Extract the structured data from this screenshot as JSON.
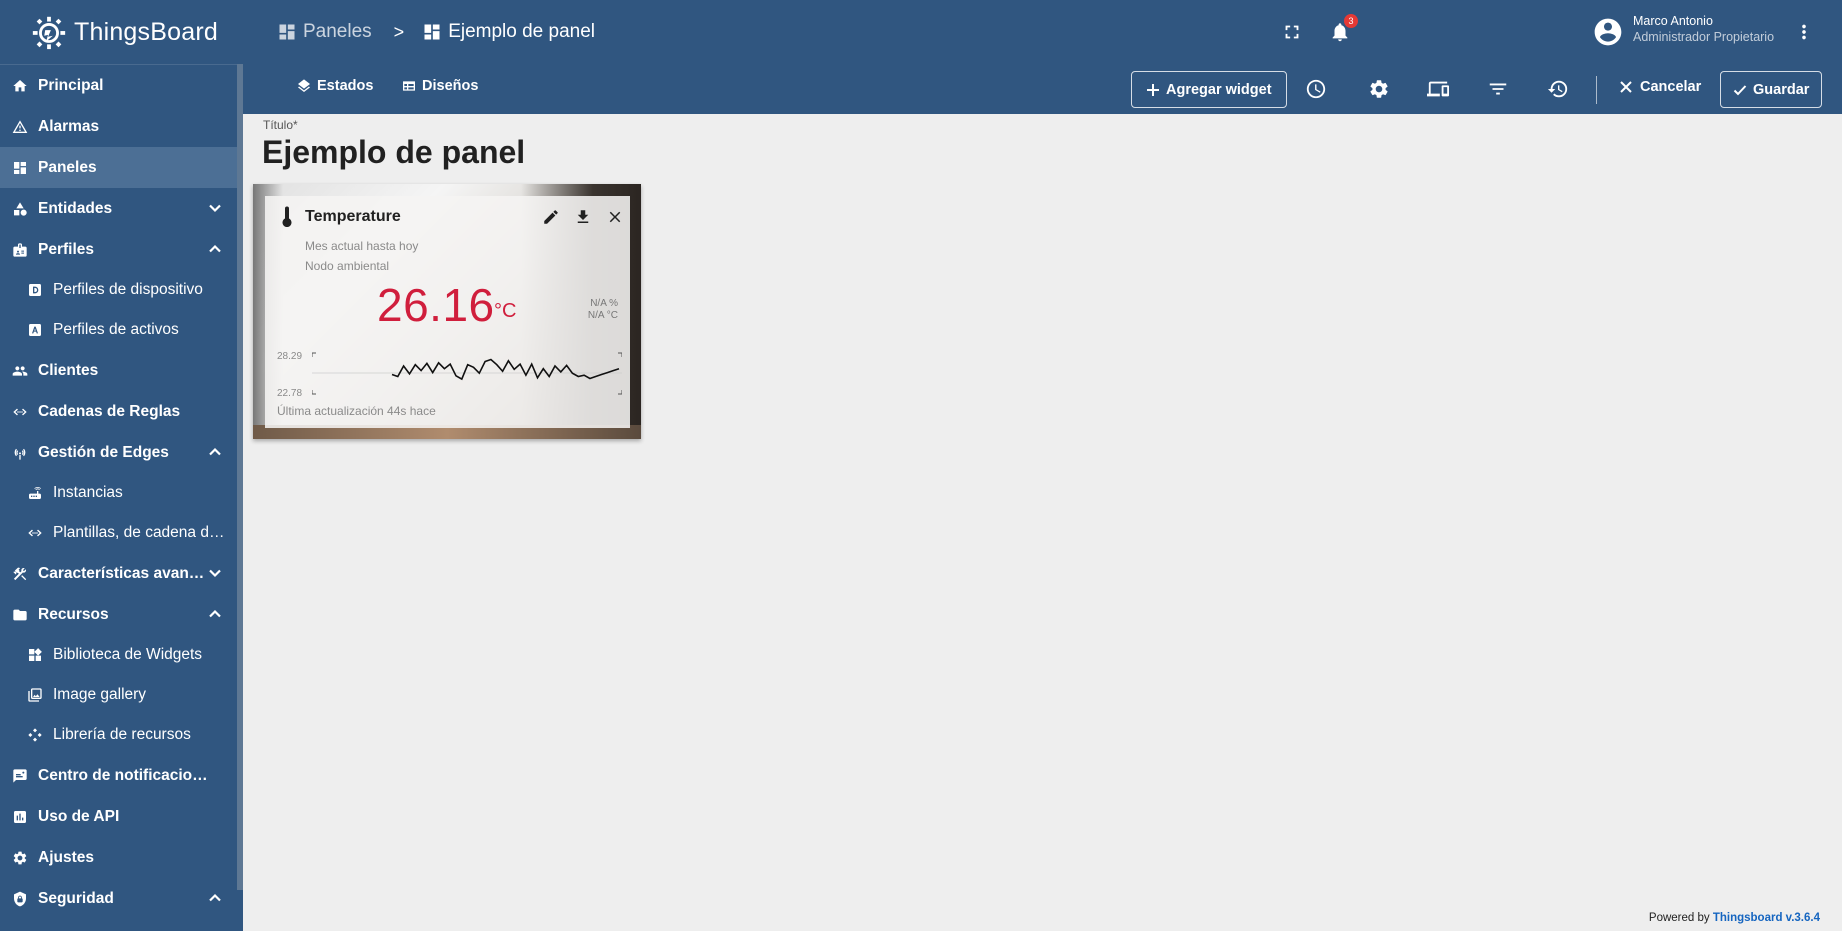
{
  "app": {
    "name": "ThingsBoard"
  },
  "sidebar": {
    "items": [
      {
        "label": "Principal",
        "icon": "home-icon",
        "sub": false,
        "active": false,
        "chevron": ""
      },
      {
        "label": "Alarmas",
        "icon": "alarm-warning-icon",
        "sub": false,
        "active": false,
        "chevron": ""
      },
      {
        "label": "Paneles",
        "icon": "dashboard-icon",
        "sub": false,
        "active": true,
        "chevron": ""
      },
      {
        "label": "Entidades",
        "icon": "entities-icon",
        "sub": false,
        "active": false,
        "chevron": "down"
      },
      {
        "label": "Perfiles",
        "icon": "profiles-icon",
        "sub": false,
        "active": false,
        "chevron": "up"
      },
      {
        "label": "Perfiles de dispositivo",
        "icon": "device-profile-icon",
        "sub": true,
        "active": false,
        "chevron": ""
      },
      {
        "label": "Perfiles de activos",
        "icon": "asset-profile-icon",
        "sub": true,
        "active": false,
        "chevron": ""
      },
      {
        "label": "Clientes",
        "icon": "customers-icon",
        "sub": false,
        "active": false,
        "chevron": ""
      },
      {
        "label": "Cadenas de Reglas",
        "icon": "rule-chain-icon",
        "sub": false,
        "active": false,
        "chevron": ""
      },
      {
        "label": "Gestión de Edges",
        "icon": "edge-icon",
        "sub": false,
        "active": false,
        "chevron": "up"
      },
      {
        "label": "Instancias",
        "icon": "router-icon",
        "sub": true,
        "active": false,
        "chevron": ""
      },
      {
        "label": "Plantillas, de cadena de reglas",
        "icon": "rule-chain-icon",
        "sub": true,
        "active": false,
        "chevron": ""
      },
      {
        "label": "Características avanzadas",
        "icon": "tools-icon",
        "sub": false,
        "active": false,
        "chevron": "down"
      },
      {
        "label": "Recursos",
        "icon": "folder-icon",
        "sub": false,
        "active": false,
        "chevron": "up"
      },
      {
        "label": "Biblioteca de Widgets",
        "icon": "widgets-icon",
        "sub": true,
        "active": false,
        "chevron": ""
      },
      {
        "label": "Image gallery",
        "icon": "image-gallery-icon",
        "sub": true,
        "active": false,
        "chevron": ""
      },
      {
        "label": "Librería de recursos",
        "icon": "resources-icon",
        "sub": true,
        "active": false,
        "chevron": ""
      },
      {
        "label": "Centro de notificaciones",
        "icon": "notification-center-icon",
        "sub": false,
        "active": false,
        "chevron": ""
      },
      {
        "label": "Uso de API",
        "icon": "api-usage-icon",
        "sub": false,
        "active": false,
        "chevron": ""
      },
      {
        "label": "Ajustes",
        "icon": "settings-icon",
        "sub": false,
        "active": false,
        "chevron": ""
      },
      {
        "label": "Seguridad",
        "icon": "security-icon",
        "sub": false,
        "active": false,
        "chevron": "up"
      }
    ]
  },
  "topbar": {
    "breadcrumb_root": "Paneles",
    "breadcrumb_sep": ">",
    "breadcrumb_current": "Ejemplo de panel",
    "notifications_count": "3",
    "user_name": "Marco Antonio",
    "user_role": "Administrador Propietario"
  },
  "toolbar": {
    "states_label": "Estados",
    "layouts_label": "Diseños",
    "add_widget_label": "Agregar widget",
    "cancel_label": "Cancelar",
    "save_label": "Guardar"
  },
  "main": {
    "title_label": "Título*",
    "title_value": "Ejemplo de panel"
  },
  "widget": {
    "title": "Temperature",
    "subtitle": "Mes actual hasta hoy",
    "device": "Nodo ambiental",
    "value": "26.16",
    "unit": "°C",
    "na_percent": "N/A %",
    "na_celsius": "N/A °C",
    "y_max": "28.29",
    "y_min": "22.78",
    "updated": "Última actualización 44s hace",
    "value_color": "#d01e3c"
  },
  "chart_data": {
    "type": "line",
    "title": "",
    "ylim": [
      22.78,
      28.29
    ],
    "values": [
      25.3,
      25.0,
      26.6,
      25.4,
      26.8,
      25.9,
      27.0,
      25.6,
      27.1,
      26.2,
      26.9,
      25.1,
      24.6,
      26.8,
      26.4,
      25.5,
      27.3,
      27.6,
      26.8,
      25.8,
      27.4,
      26.1,
      26.9,
      25.2,
      26.9,
      24.8,
      26.2,
      25.0,
      26.6,
      25.7,
      26.7,
      25.5,
      25.0,
      25.2,
      24.7,
      25.0,
      25.3,
      25.6,
      25.9,
      26.2
    ]
  },
  "footer": {
    "powered_by": "Powered by",
    "version": "Thingsboard v.3.6.4"
  },
  "colors": {
    "primary": "#305680",
    "sidebar_active": "#4c6f95",
    "background": "#eeeeee"
  }
}
